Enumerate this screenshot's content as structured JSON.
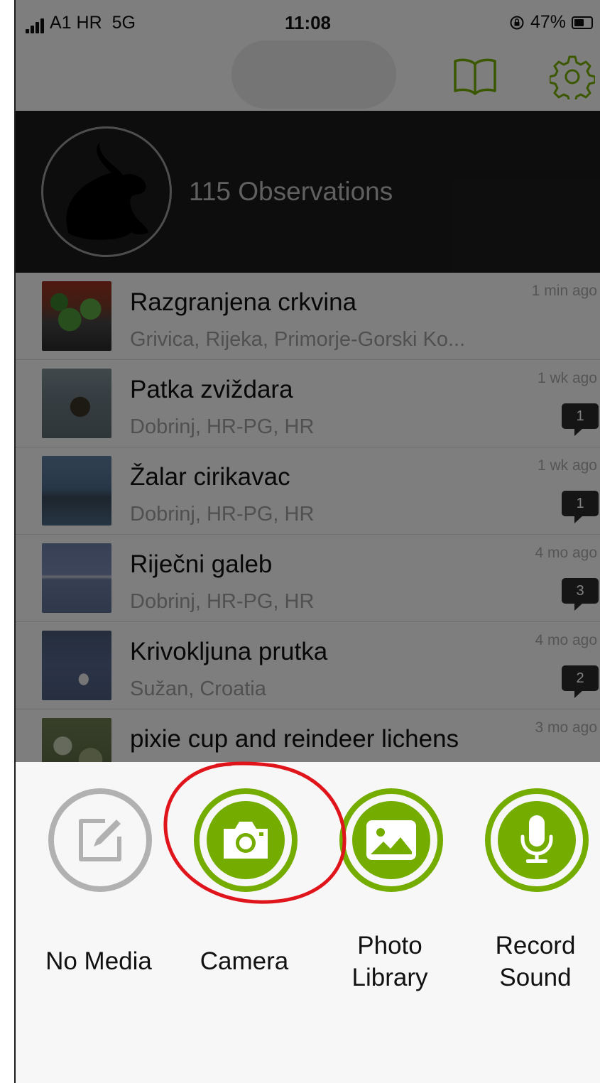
{
  "status_bar": {
    "carrier": "A1 HR",
    "network": "5G",
    "time": "11:08",
    "battery": "47%"
  },
  "header": {
    "guide_icon": "book-icon",
    "settings_icon": "gear-icon",
    "accent": "#74ac00"
  },
  "profile": {
    "observations": "115 Observations",
    "avatar_icon": "hare-icon"
  },
  "observations": [
    {
      "title": "Razgranjena crkvina",
      "place": "Grivica, Rijeka, Primorje-Gorski Ko...",
      "time": "1 min ago",
      "comments": ""
    },
    {
      "title": "Patka zviždara",
      "place": "Dobrinj, HR-PG, HR",
      "time": "1 wk ago",
      "comments": "1"
    },
    {
      "title": "Žalar cirikavac",
      "place": "Dobrinj, HR-PG, HR",
      "time": "1 wk ago",
      "comments": "1"
    },
    {
      "title": "Riječni galeb",
      "place": "Dobrinj, HR-PG, HR",
      "time": "4 mo ago",
      "comments": "3"
    },
    {
      "title": "Krivokljuna prutka",
      "place": "Sužan, Croatia",
      "time": "4 mo ago",
      "comments": "2"
    },
    {
      "title": "pixie cup and reindeer lichens",
      "place": "",
      "time": "3 mo ago",
      "comments": ""
    }
  ],
  "sheet": {
    "options": [
      {
        "label_lines": [
          "No Media"
        ],
        "icon": "edit-icon"
      },
      {
        "label_lines": [
          "Camera"
        ],
        "icon": "camera-icon"
      },
      {
        "label_lines": [
          "Photo",
          "Library"
        ],
        "icon": "photo-icon"
      },
      {
        "label_lines": [
          "Record",
          "Sound"
        ],
        "icon": "microphone-icon"
      }
    ],
    "annotation_color": "#e0141b"
  }
}
